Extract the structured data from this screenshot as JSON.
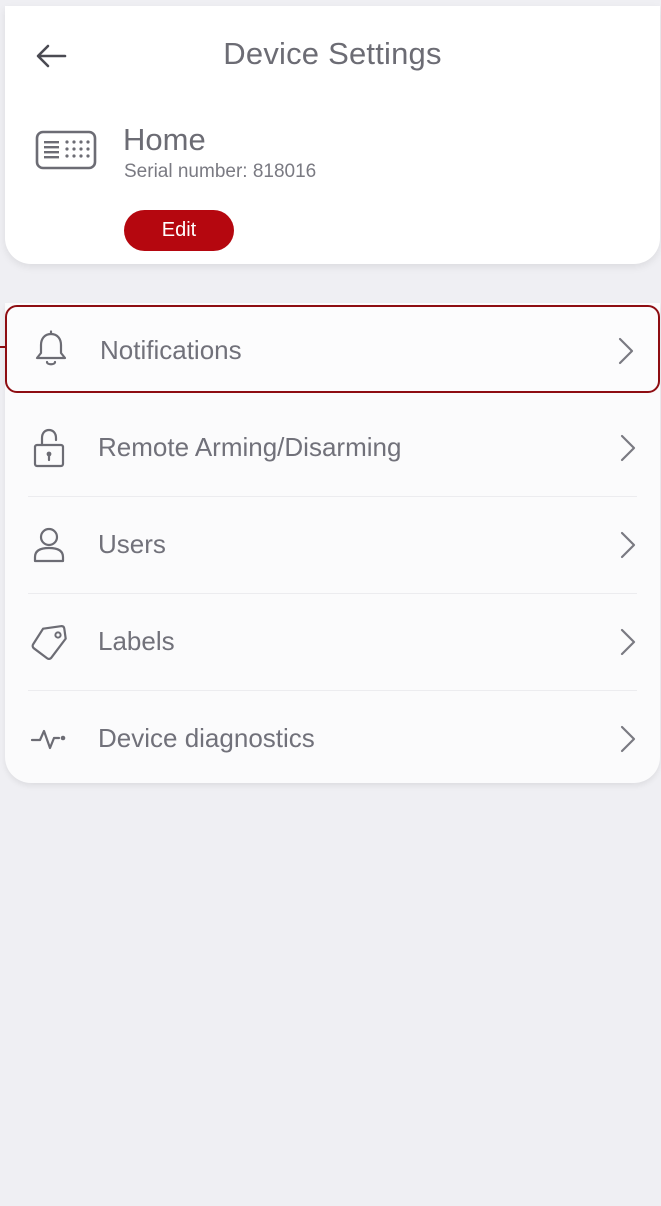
{
  "header": {
    "title": "Device Settings",
    "back_icon": "arrow-left-icon"
  },
  "device": {
    "icon": "keypad-icon",
    "name": "Home",
    "serial": "Serial number: 818016",
    "edit_label": "Edit"
  },
  "menu": {
    "items": [
      {
        "label": "Notifications",
        "icon": "bell-icon",
        "highlighted": true
      },
      {
        "label": "Remote Arming/Disarming",
        "icon": "lock-icon"
      },
      {
        "label": "Users",
        "icon": "user-icon"
      },
      {
        "label": "Labels",
        "icon": "tag-icon"
      },
      {
        "label": "Device diagnostics",
        "icon": "pulse-icon"
      }
    ]
  },
  "colors": {
    "accent": "#b5070f",
    "highlight_border": "#8e0d12",
    "background": "#efeff3",
    "text": "#71717a"
  }
}
